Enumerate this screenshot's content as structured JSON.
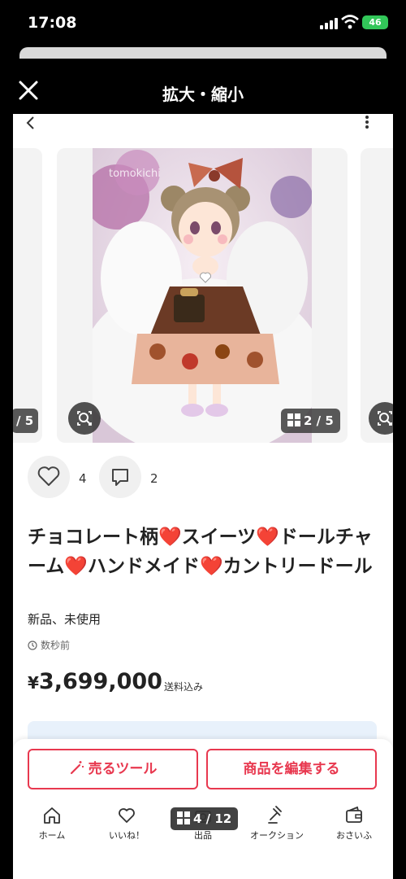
{
  "status_bar": {
    "time": "17:08",
    "battery": "46"
  },
  "zoom_header": {
    "title": "拡大・縮小"
  },
  "carousel": {
    "left_counter": "/ 5",
    "main_counter": "2 / 5",
    "photo_watermark": "tomokichi"
  },
  "engagement": {
    "likes": "4",
    "comments": "2"
  },
  "item": {
    "title": "チョコレート柄❤️スイーツ❤️ドールチャーム❤️ハンドメイド❤️カントリードール",
    "condition": "新品、未使用",
    "posted": "数秒前",
    "price_symbol": "¥",
    "price": "3,699,000",
    "shipping": "送料込み"
  },
  "actions": {
    "sell_tool": "売るツール",
    "edit_item": "商品を編集する"
  },
  "tabs": [
    {
      "label": "ホーム",
      "icon": "home-icon"
    },
    {
      "label": "いいね！",
      "icon": "heart-icon"
    },
    {
      "label": "出品",
      "icon": "camera-icon"
    },
    {
      "label": "オークション",
      "icon": "gavel-icon"
    },
    {
      "label": "おさいふ",
      "icon": "wallet-icon"
    }
  ],
  "overlay_page_count": "4 / 12",
  "colors": {
    "accent": "#e8384f",
    "battery": "#32c759"
  }
}
